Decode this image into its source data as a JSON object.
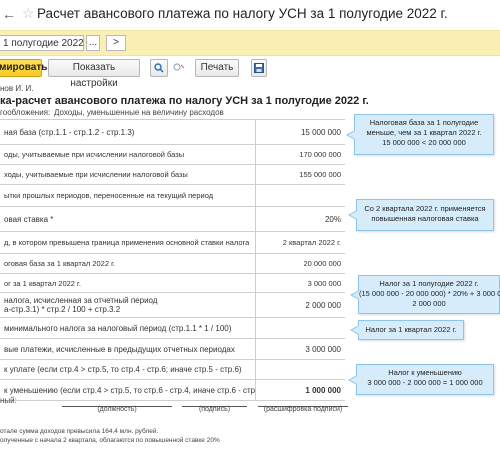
{
  "window": {
    "title": "Расчет авансового платежа по налогу УСН за 1 полугодие 2022 г.",
    "back_icon": "arrow-left-icon",
    "forward_icon": "arrow-right-icon",
    "favorite_icon": "star-icon"
  },
  "period_bar": {
    "period_value": "1 полугодие 2022 г.",
    "choose_label": "...",
    "generate_label": ">"
  },
  "toolbar": {
    "generate_label": "мировать",
    "settings_label": "Показать настройки",
    "search_icon": "search-icon",
    "search_cancel_icon": "search-cancel-icon",
    "print_label": "Печать",
    "save_icon": "save-icon"
  },
  "report": {
    "header_org": "нов И. И.",
    "title": "ка-расчет авансового платежа по налогу УСН за 1 полугодие 2022 г.",
    "tax_object_label": "гообложения:",
    "tax_object_value": "Доходы, уменьшенные на величину расходов",
    "rows": [
      {
        "label": "ная база (стр.1.1 - стр.1.2 - стр.1.3)",
        "value": "15 000 000"
      },
      {
        "label": "оды, учитываемые при исчислении налоговой базы",
        "value": "170 000 000"
      },
      {
        "label": "ходы, учитываемые при исчислении налоговой базы",
        "value": "155 000 000"
      },
      {
        "label": "ытки прошлых периодов, переносенные на текущий период",
        "value": ""
      },
      {
        "label": "овая ставка *",
        "value": "20%"
      },
      {
        "label": "д, в котором превышена граница применения основной ставки налога",
        "value": "2 квартал 2022 г."
      },
      {
        "label": "оговая база за 1 квартал 2022 г.",
        "value": "20 000 000"
      },
      {
        "label": "ог за 1 квартал 2022 г.",
        "value": "3 000 000"
      },
      {
        "label": "налога, исчисленная за отчетный период",
        "label2": "а-стр.3.1) * стр.2 / 100 + стр.3.2",
        "value": "2 000 000"
      },
      {
        "label": "минимального налога за налоговый период (стр.1.1 * 1 / 100)",
        "value": ""
      },
      {
        "label": "вые платежи, исчисленные в предыдущих отчетных периодах",
        "value": "3 000 000"
      },
      {
        "label": "к уплате (если стр.4 > стр.5, то стр.4 - стр.6; иначе стр.5 - стр.6)",
        "value": ""
      },
      {
        "label": "к уменьшению (если стр.4 > стр.5, то стр.6 - стр.4, иначе стр.6 - стр.5)",
        "value": "1 000 000"
      }
    ],
    "signature": {
      "label": "ный:",
      "position_caption": "(должность)",
      "sign_caption": "(подпись)",
      "decode_caption": "(расшифровка подписи)"
    },
    "footnote_1": "отале сумма доходов превысила 164,4 млн. рублей.",
    "footnote_2": "олученные с начала 2 квартала, облагаются по повышенной ставке 20%"
  },
  "callouts": {
    "c1": [
      "Налоговая база за 1 полугодие",
      "меньше, чем за 1 квартал 2022 г.",
      "15 000 000 < 20 000 000"
    ],
    "c2": [
      "Со 2 квартала 2022 г. применяется",
      "повышенная налоговая ставка"
    ],
    "c3": [
      "Налог за 1 полугодие 2022 г.",
      "(15 000 000 - 20 000 000) * 20% + 3 000 000 =",
      "2 000 000"
    ],
    "c4": [
      "Налог за 1 квартал 2022 г."
    ],
    "c5": [
      "Налог к уменьшению",
      "3 000 000 - 2 000 000 = 1 000 000"
    ]
  },
  "colors": {
    "period_bar": "#fbf0b4",
    "primary_button": "#f4c824",
    "callout_bg": "#d7ecfb",
    "callout_border": "#8ec4ec"
  }
}
